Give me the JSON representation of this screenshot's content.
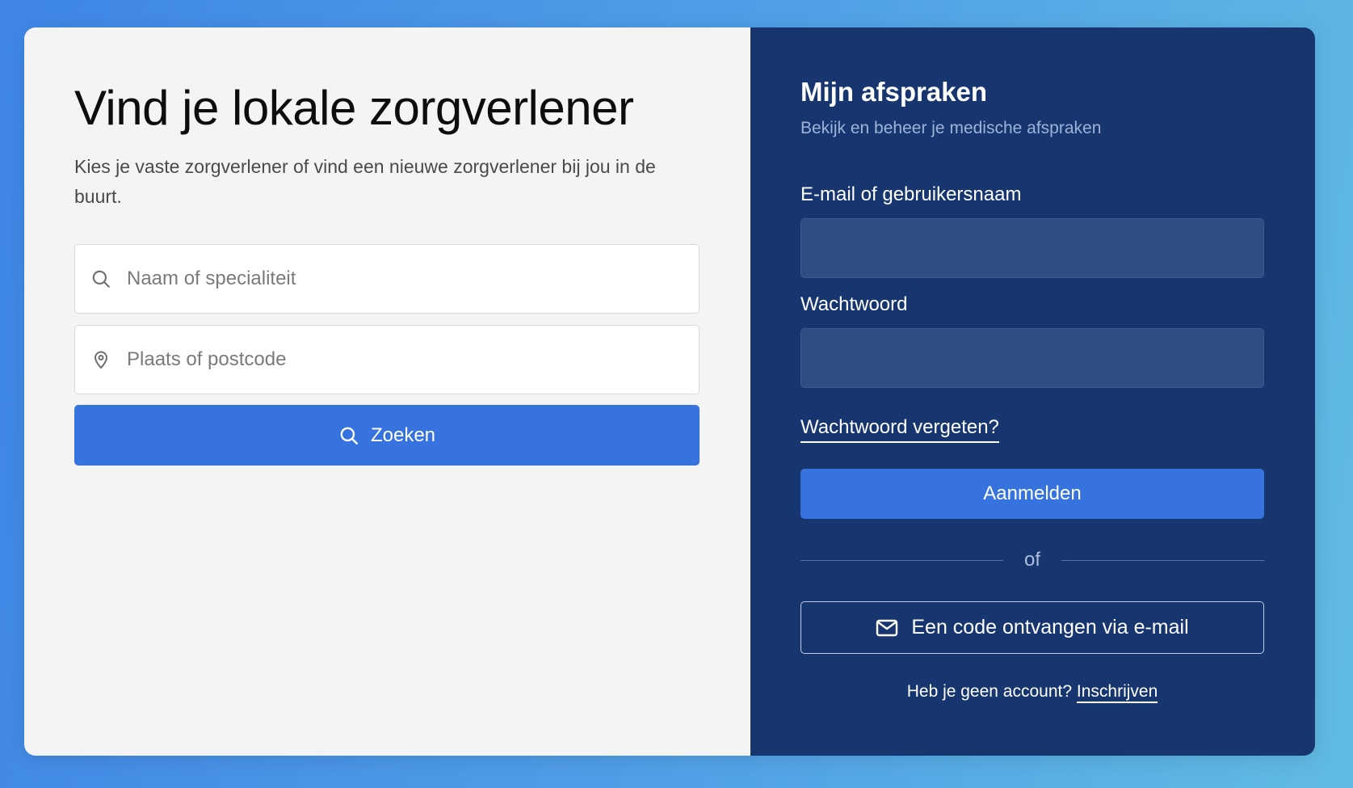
{
  "colors": {
    "background_gradient_start": "#3f86e6",
    "background_gradient_end": "#61bae3",
    "left_panel_bg": "#f4f4f4",
    "right_panel_bg": "#17366f",
    "primary_button": "#3673de",
    "input_dark_bg": "#2f4d83"
  },
  "search_panel": {
    "title": "Vind je lokale zorgverlener",
    "subtitle": "Kies je vaste zorgverlener of vind een nieuwe zorgverlener bij jou in de buurt.",
    "name_field": {
      "icon": "search-icon",
      "placeholder": "Naam of specialiteit",
      "value": ""
    },
    "location_field": {
      "icon": "map-pin-icon",
      "placeholder": "Plaats of postcode",
      "value": ""
    },
    "search_button": {
      "icon": "search-icon",
      "label": "Zoeken"
    }
  },
  "login_panel": {
    "title": "Mijn afspraken",
    "subtitle": "Bekijk en beheer je medische afspraken",
    "email_label": "E-mail of gebruikersnaam",
    "email_value": "",
    "password_label": "Wachtwoord",
    "password_value": "",
    "forgot_link": "Wachtwoord vergeten?",
    "login_button": "Aanmelden",
    "divider_text": "of",
    "email_code_button": {
      "icon": "envelope-icon",
      "label": "Een code ontvangen via e-mail"
    },
    "signup_prompt": "Heb je geen account?",
    "signup_link": "Inschrijven"
  }
}
